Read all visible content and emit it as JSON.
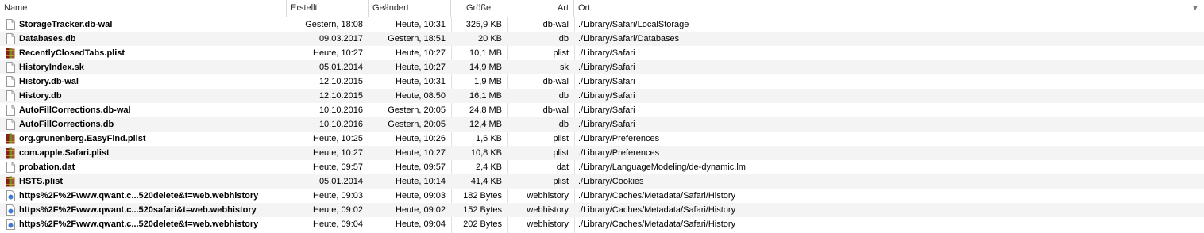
{
  "columns": {
    "name": "Name",
    "created": "Erstellt",
    "modified": "Geändert",
    "size": "Größe",
    "kind": "Art",
    "location": "Ort"
  },
  "sort_indicator": "▼",
  "rows": [
    {
      "name": "StorageTracker.db-wal",
      "icon": "document-icon",
      "created": "Gestern, 18:08",
      "modified": "Heute, 10:31",
      "size": "325,9 KB",
      "kind": "db-wal",
      "location": "./Library/Safari/LocalStorage"
    },
    {
      "name": "Databases.db",
      "icon": "document-icon",
      "created": "09.03.2017",
      "modified": "Gestern, 18:51",
      "size": "20 KB",
      "kind": "db",
      "location": "./Library/Safari/Databases"
    },
    {
      "name": "RecentlyClosedTabs.plist",
      "icon": "plist-icon",
      "created": "Heute, 10:27",
      "modified": "Heute, 10:27",
      "size": "10,1 MB",
      "kind": "plist",
      "location": "./Library/Safari"
    },
    {
      "name": "HistoryIndex.sk",
      "icon": "document-icon",
      "created": "05.01.2014",
      "modified": "Heute, 10:27",
      "size": "14,9 MB",
      "kind": "sk",
      "location": "./Library/Safari"
    },
    {
      "name": "History.db-wal",
      "icon": "document-icon",
      "created": "12.10.2015",
      "modified": "Heute, 10:31",
      "size": "1,9 MB",
      "kind": "db-wal",
      "location": "./Library/Safari"
    },
    {
      "name": "History.db",
      "icon": "document-icon",
      "created": "12.10.2015",
      "modified": "Heute, 08:50",
      "size": "16,1 MB",
      "kind": "db",
      "location": "./Library/Safari"
    },
    {
      "name": "AutoFillCorrections.db-wal",
      "icon": "document-icon",
      "created": "10.10.2016",
      "modified": "Gestern, 20:05",
      "size": "24,8 MB",
      "kind": "db-wal",
      "location": "./Library/Safari"
    },
    {
      "name": "AutoFillCorrections.db",
      "icon": "document-icon",
      "created": "10.10.2016",
      "modified": "Gestern, 20:05",
      "size": "12,4 MB",
      "kind": "db",
      "location": "./Library/Safari"
    },
    {
      "name": "org.grunenberg.EasyFind.plist",
      "icon": "plist-icon",
      "created": "Heute, 10:25",
      "modified": "Heute, 10:26",
      "size": "1,6 KB",
      "kind": "plist",
      "location": "./Library/Preferences"
    },
    {
      "name": "com.apple.Safari.plist",
      "icon": "plist-icon",
      "created": "Heute, 10:27",
      "modified": "Heute, 10:27",
      "size": "10,8 KB",
      "kind": "plist",
      "location": "./Library/Preferences"
    },
    {
      "name": "probation.dat",
      "icon": "document-icon",
      "created": "Heute, 09:57",
      "modified": "Heute, 09:57",
      "size": "2,4 KB",
      "kind": "dat",
      "location": "./Library/LanguageModeling/de-dynamic.lm"
    },
    {
      "name": "HSTS.plist",
      "icon": "plist-icon",
      "created": "05.01.2014",
      "modified": "Heute, 10:14",
      "size": "41,4 KB",
      "kind": "plist",
      "location": "./Library/Cookies"
    },
    {
      "name": "https%2F%2Fwww.qwant.c...520delete&t=web.webhistory",
      "icon": "webhistory-icon",
      "created": "Heute, 09:03",
      "modified": "Heute, 09:03",
      "size": "182 Bytes",
      "kind": "webhistory",
      "location": "./Library/Caches/Metadata/Safari/History"
    },
    {
      "name": "https%2F%2Fwww.qwant.c...520safari&t=web.webhistory",
      "icon": "webhistory-icon",
      "created": "Heute, 09:02",
      "modified": "Heute, 09:02",
      "size": "152 Bytes",
      "kind": "webhistory",
      "location": "./Library/Caches/Metadata/Safari/History"
    },
    {
      "name": "https%2F%2Fwww.qwant.c...520delete&t=web.webhistory",
      "icon": "webhistory-icon",
      "created": "Heute, 09:04",
      "modified": "Heute, 09:04",
      "size": "202 Bytes",
      "kind": "webhistory",
      "location": "./Library/Caches/Metadata/Safari/History"
    }
  ],
  "colors": {
    "row_alt": "#f4f4f4",
    "header_text": "#2a2a2a",
    "plist_icon_book": "#6b8e23",
    "webhistory_icon": "#3b7bd4"
  }
}
